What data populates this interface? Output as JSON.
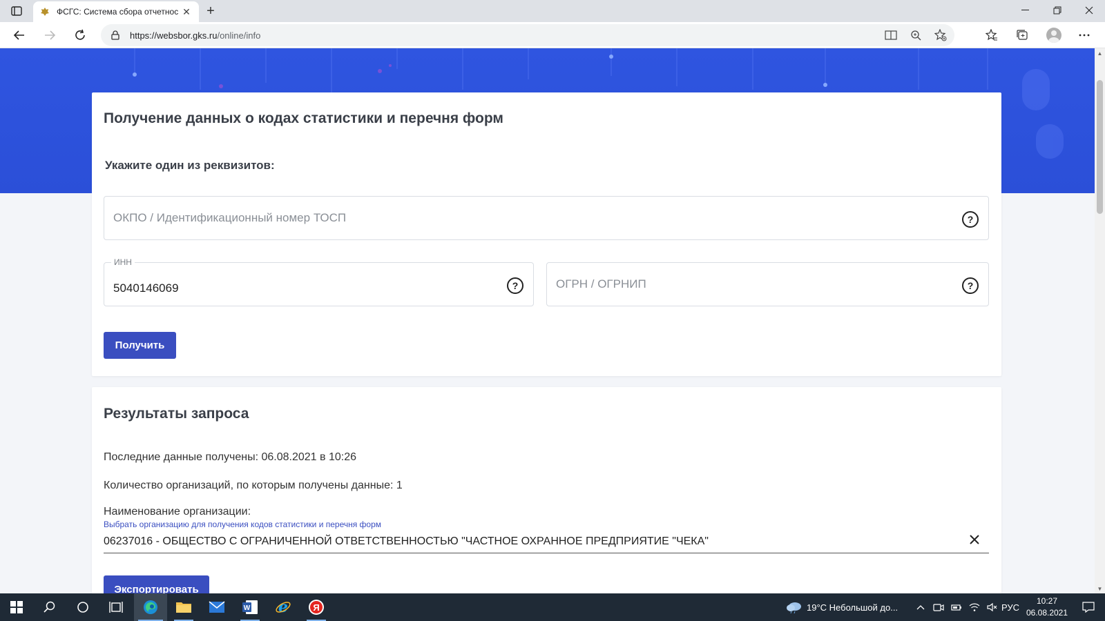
{
  "browser": {
    "tab_title": "ФСГС: Система сбора отчетнос",
    "url_domain": "https://websbor.gks.ru",
    "url_path": "/online/info"
  },
  "form": {
    "heading": "Получение данных о кодах статистики и перечня форм",
    "subheading": "Укажите один из реквизитов:",
    "okpo_placeholder": "ОКПО / Идентификационный номер ТОСП",
    "inn_label": "ИНН",
    "inn_value": "5040146069",
    "ogrn_placeholder": "ОГРН / ОГРНИП",
    "help_glyph": "?",
    "submit_label": "Получить"
  },
  "results": {
    "heading": "Результаты запроса",
    "last_received": "Последние данные получены: 06.08.2021 в 10:26",
    "org_count": "Количество организаций, по которым получены данные: 1",
    "org_label": "Наименование организации:",
    "org_hint": "Выбрать организацию для получения кодов статистики и перечня форм",
    "org_value": "06237016 - ОБЩЕСТВО С ОГРАНИЧЕННОЙ ОТВЕТСТВЕННОСТЬЮ \"ЧАСТНОЕ ОХРАННОЕ ПРЕДПРИЯТИЕ \"ЧЕКА\"",
    "export_label": "Экспортировать"
  },
  "taskbar": {
    "weather": "19°C  Небольшой до...",
    "language": "РУС",
    "time": "10:27",
    "date": "06.08.2021"
  },
  "colors": {
    "accent": "#3a4ec0",
    "hero": "#2f55e0",
    "taskbar": "#1f2a36"
  }
}
